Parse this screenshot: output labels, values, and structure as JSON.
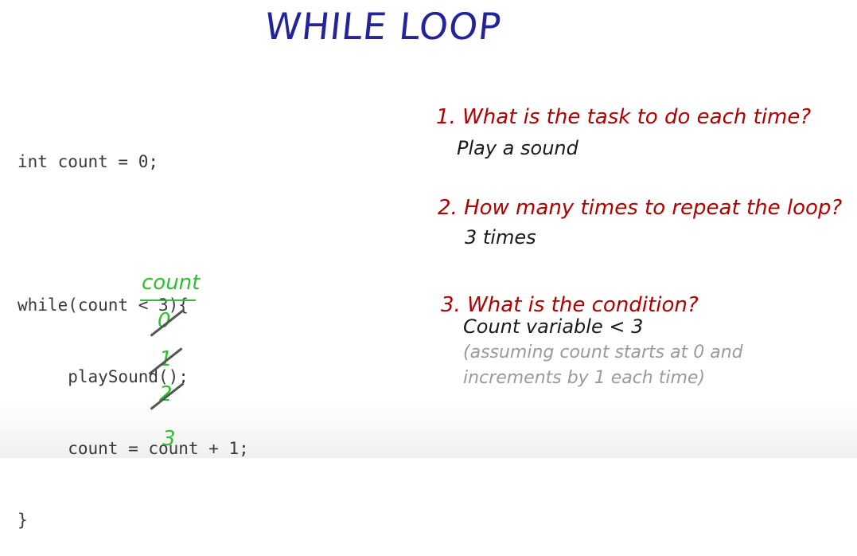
{
  "title": "WHILE LOOP",
  "code": {
    "lines": [
      "int count = 0;",
      "",
      "while(count < 3){",
      "     playSound();",
      "     count = count + 1;",
      "}"
    ]
  },
  "count_table": {
    "header": "count",
    "values": [
      "0",
      "1",
      "2",
      "3"
    ],
    "crossed_out": [
      "0",
      "1",
      "2"
    ]
  },
  "questions": [
    {
      "question": "1. What is the task to do each time?",
      "answer": "Play a sound"
    },
    {
      "question": "2. How many times to repeat the loop?",
      "answer": "3 times"
    },
    {
      "question": "3. What is the condition?",
      "answer": "Count variable < 3"
    }
  ],
  "note": {
    "line1": "(assuming count starts at 0 and",
    "line2": "increments by 1 each time)"
  },
  "colors": {
    "title": "#24249a",
    "question": "#b00000",
    "count": "#2fbf2f",
    "note": "#9a9a9a"
  }
}
